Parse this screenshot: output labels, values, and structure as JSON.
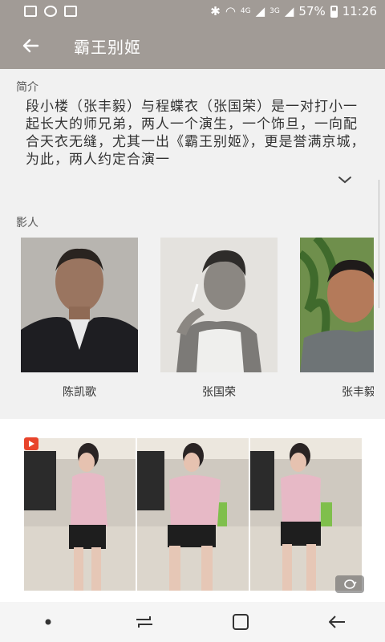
{
  "status": {
    "battery": "57%",
    "time": "11:26",
    "net_a": "4G",
    "net_b": "3G"
  },
  "app_bar": {
    "title": "霸王别姬"
  },
  "intro": {
    "label": "简介",
    "text": "段小楼（张丰毅）与程蝶衣（张国荣）是一对打小一起长大的师兄弟，两人一个演生，一个饰旦，一向配合天衣无缝，尤其一出《霸王别姬》，更是誉满京城，为此，两人约定合演一"
  },
  "cast": {
    "label": "影人",
    "items": [
      {
        "name": "陈凯歌"
      },
      {
        "name": "张国荣"
      },
      {
        "name": "张丰毅"
      }
    ]
  },
  "colors": {
    "app_bar": "#a19b96",
    "badge": "#e8442b"
  }
}
